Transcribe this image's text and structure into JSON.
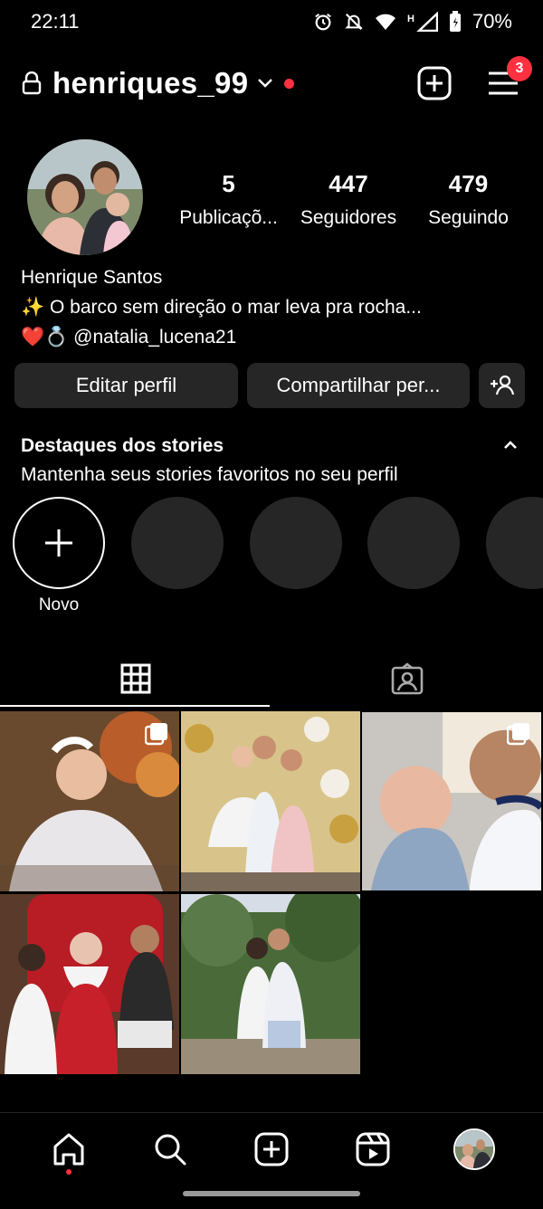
{
  "status_bar": {
    "time": "22:11",
    "battery": "70%"
  },
  "header": {
    "username": "henriques_99",
    "notifications_count": "3"
  },
  "profile": {
    "stats": [
      {
        "value": "5",
        "label": "Publicaçõ..."
      },
      {
        "value": "447",
        "label": "Seguidores"
      },
      {
        "value": "479",
        "label": "Seguindo"
      }
    ],
    "name": "Henrique Santos",
    "bio_line1": "✨ O barco sem direção o mar leva pra rocha...",
    "bio_line2_emojis": "❤️💍",
    "bio_mention": "@natalia_lucena21"
  },
  "buttons": {
    "edit": "Editar perfil",
    "share": "Compartilhar per..."
  },
  "highlights": {
    "title": "Destaques dos stories",
    "subtitle": "Mantenha seus stories favoritos no seu perfil",
    "new_label": "Novo"
  },
  "colors": {
    "accent_red": "#ff3040",
    "button_bg": "#262626",
    "background": "#000000"
  },
  "icons": {
    "status": [
      "alarm-icon",
      "mute-icon",
      "wifi-icon",
      "signal-icon",
      "battery-icon"
    ],
    "header": [
      "lock-icon",
      "chevron-down-icon",
      "new-post-icon",
      "menu-icon"
    ],
    "tabs": [
      "grid-icon",
      "tagged-icon"
    ],
    "nav": [
      "home-icon",
      "search-icon",
      "create-icon",
      "reels-icon",
      "profile-avatar"
    ]
  }
}
